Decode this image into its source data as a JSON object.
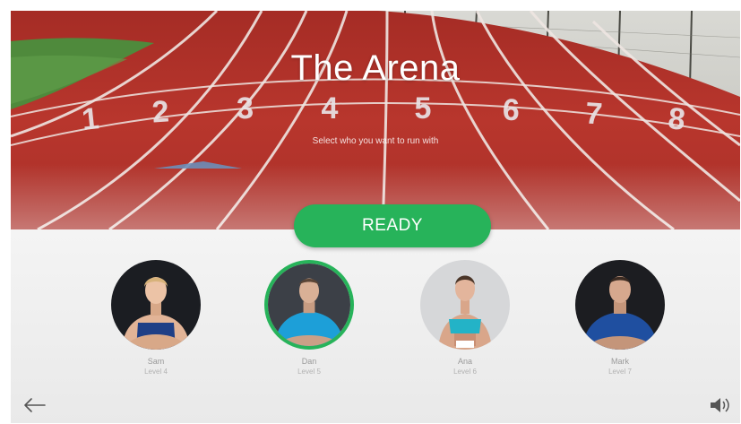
{
  "screen": {
    "title": "The Arena",
    "subtitle": "Select who you want to run with",
    "ready_label": "READY"
  },
  "track": {
    "lane_numbers": [
      "1",
      "2",
      "3",
      "4",
      "5",
      "6",
      "7",
      "8"
    ]
  },
  "runners": [
    {
      "name": "Sam",
      "level": "Level 4",
      "selected": false
    },
    {
      "name": "Dan",
      "level": "Level 5",
      "selected": true
    },
    {
      "name": "Ana",
      "level": "Level 6",
      "selected": false
    },
    {
      "name": "Mark",
      "level": "Level 7",
      "selected": false
    }
  ],
  "icons": {
    "back": "arrow-left-icon",
    "sound": "speaker-icon"
  },
  "colors": {
    "accent": "#27b35a",
    "track": "#b5332b",
    "panel": "#f1f1f1"
  }
}
